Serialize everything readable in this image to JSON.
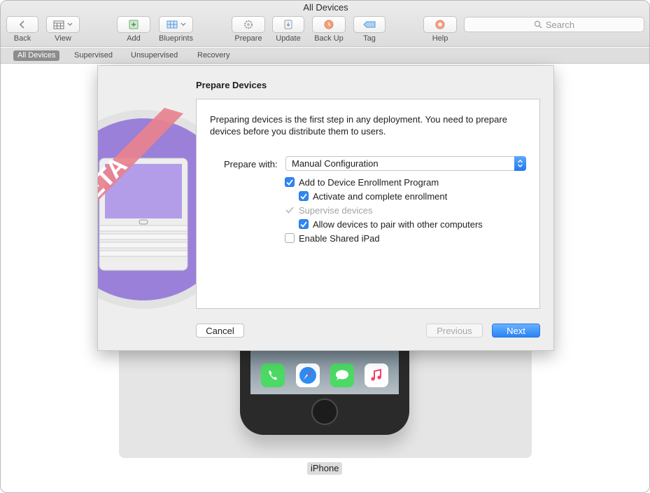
{
  "window": {
    "title": "All Devices"
  },
  "toolbar": {
    "back_label": "Back",
    "view_label": "View",
    "add_label": "Add",
    "blueprints_label": "Blueprints",
    "prepare_label": "Prepare",
    "update_label": "Update",
    "backup_label": "Back Up",
    "tag_label": "Tag",
    "help_label": "Help",
    "search_placeholder": "Search"
  },
  "scopes": [
    "All Devices",
    "Supervised",
    "Unsupervised",
    "Recovery"
  ],
  "active_scope": "All Devices",
  "device": {
    "name": "iPhone"
  },
  "sheet": {
    "title": "Prepare Devices",
    "intro": "Preparing devices is the first step in any deployment. You need to prepare devices before you distribute them to users.",
    "prepare_with_label": "Prepare with:",
    "prepare_with_value": "Manual Configuration",
    "options": [
      {
        "label": "Add to Device Enrollment Program",
        "checked": true,
        "enabled": true
      },
      {
        "label": "Activate and complete enrollment",
        "checked": true,
        "enabled": true
      },
      {
        "label": "Supervise devices",
        "checked": true,
        "enabled": false
      },
      {
        "label": "Allow devices to pair with other computers",
        "checked": true,
        "enabled": true
      },
      {
        "label": "Enable Shared iPad",
        "checked": false,
        "enabled": true
      }
    ],
    "cancel_label": "Cancel",
    "previous_label": "Previous",
    "next_label": "Next",
    "beta_badge": "BETA"
  },
  "colors": {
    "accent": "#2f86f5",
    "beta_ribbon": "#e8828e",
    "beta_circle": "#9a80d8"
  }
}
